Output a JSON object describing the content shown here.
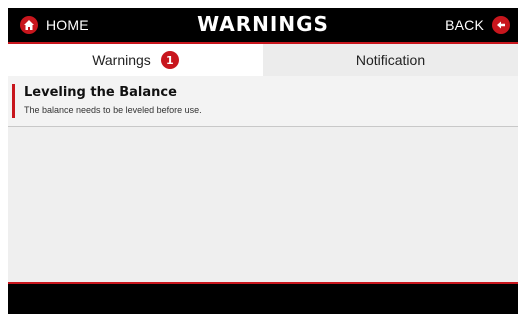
{
  "header": {
    "home_label": "HOME",
    "title": "WARNINGS",
    "back_label": "BACK",
    "home_icon": "home-icon",
    "back_icon": "back-arrow-icon"
  },
  "tabs": [
    {
      "label": "Warnings",
      "badge": "1",
      "active": true
    },
    {
      "label": "Notification",
      "active": false
    }
  ],
  "warnings": [
    {
      "title": "Leveling the Balance",
      "description": "The balance needs to be leveled before use."
    }
  ],
  "colors": {
    "accent": "#c8161d",
    "header_bg": "#000000",
    "content_bg": "#efefef"
  }
}
